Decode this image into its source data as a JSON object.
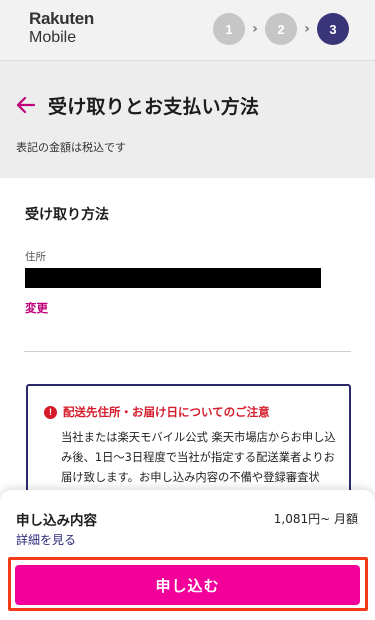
{
  "header": {
    "logo_line1": "Rakuten",
    "logo_line2": "Mobile",
    "steps": [
      "1",
      "2",
      "3"
    ],
    "active_step": "3",
    "step_separator": "›"
  },
  "page": {
    "title": "受け取りとお支払い方法",
    "tax_note": "表記の金額は税込です",
    "back_icon": "arrow-left-icon"
  },
  "receive": {
    "section_title": "受け取り方法",
    "address_label": "住所",
    "address_value": "",
    "change_label": "変更"
  },
  "notice": {
    "icon": "exclamation-icon",
    "title": "配送先住所・お届け日についてのご注意",
    "body": "当社または楽天モバイル公式 楽天市場店からお申し込み後、1日〜3日程度で当社が指定する配送業者よりお届け致します。お申し込み内容の不備や登録審査状況、または品切れ・品不足などにより"
  },
  "summary": {
    "title": "申し込み内容",
    "price": "1,081円~ 月額",
    "details_label": "詳細を見る",
    "submit_label": "申し込む"
  },
  "colors": {
    "accent_magenta": "#f20099",
    "link_magenta": "#bf0079",
    "active_step": "#3a3478",
    "warning_red": "#d51b2a",
    "highlight_outline": "#f23a1a"
  }
}
